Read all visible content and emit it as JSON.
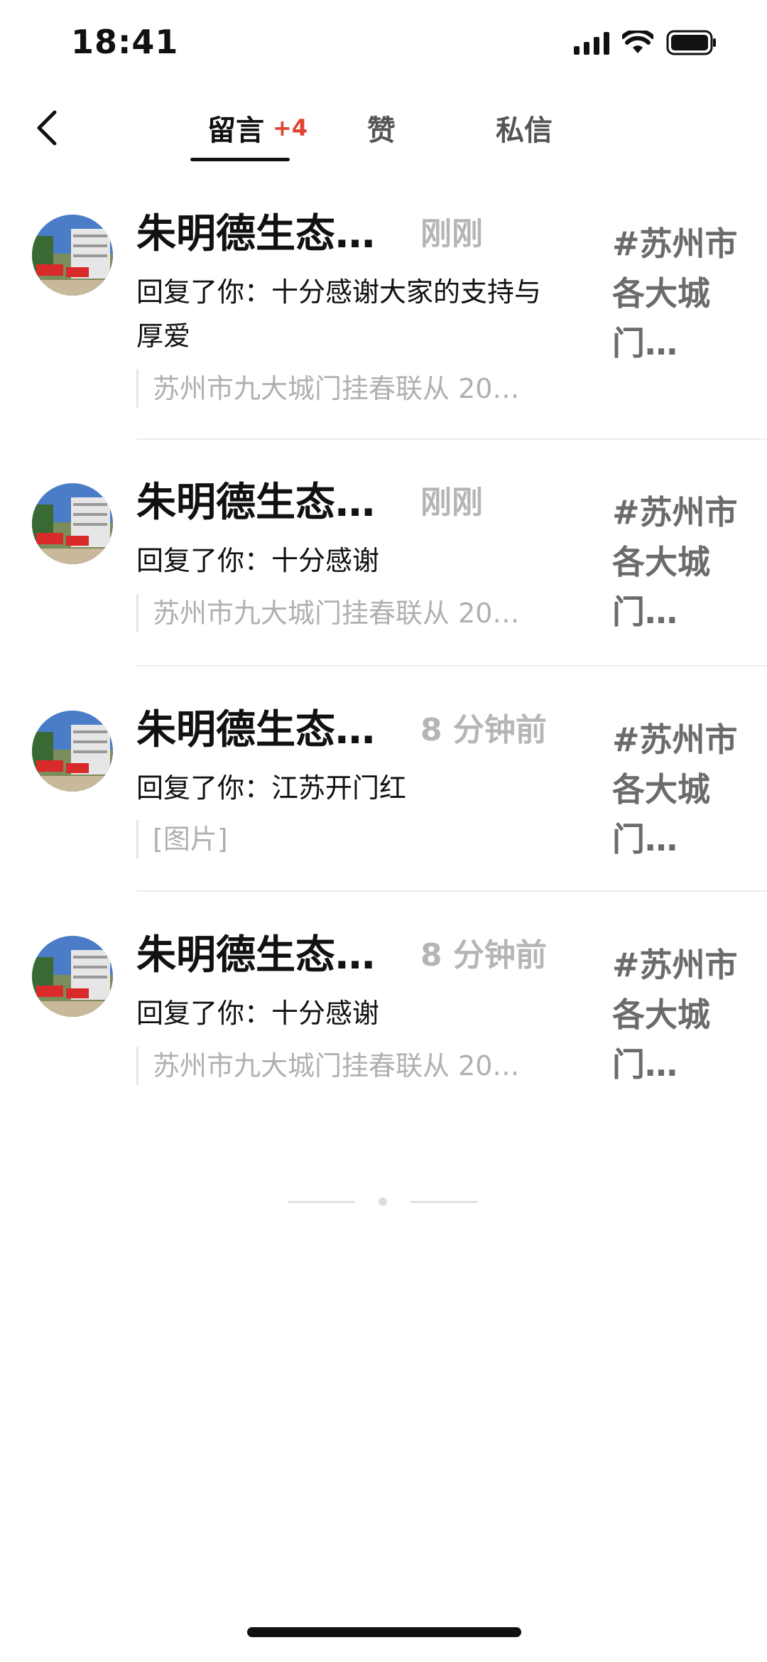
{
  "status_bar": {
    "time": "18:41",
    "icons": [
      "signal-icon",
      "wifi-icon",
      "battery-icon"
    ]
  },
  "nav": {
    "back_icon": "chevron-left-icon",
    "tabs": [
      {
        "label": "留言",
        "badge": "+4",
        "active": true
      },
      {
        "label": "赞",
        "active": false
      },
      {
        "label": "私信",
        "active": false
      }
    ]
  },
  "colors": {
    "badge": "#e0432f",
    "name": "#111111",
    "muted": "#b5b5b5",
    "topic": "#6b6b6b"
  },
  "notifications": [
    {
      "name": "朱明德生态…",
      "time": "刚刚",
      "reply": "回复了你：十分感谢大家的支持与厚爱",
      "quote": "苏州市九大城门挂春联从 20…",
      "topic": "#苏州市各大城门…"
    },
    {
      "name": "朱明德生态…",
      "time": "刚刚",
      "reply": "回复了你：十分感谢",
      "quote": "苏州市九大城门挂春联从 20…",
      "topic": "#苏州市各大城门…"
    },
    {
      "name": "朱明德生态…",
      "time": "8 分钟前",
      "reply": "回复了你：江苏开门红",
      "quote": "[图片]",
      "topic": "#苏州市各大城门…"
    },
    {
      "name": "朱明德生态…",
      "time": "8 分钟前",
      "reply": "回复了你：十分感谢",
      "quote": "苏州市九大城门挂春联从 20…",
      "topic": "#苏州市各大城门…"
    }
  ]
}
